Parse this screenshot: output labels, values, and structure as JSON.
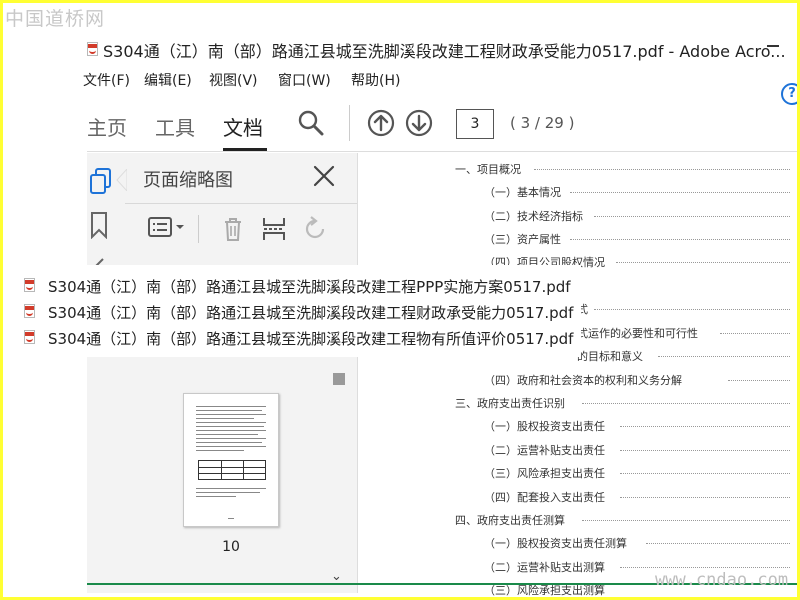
{
  "watermark_top": "中国道桥网",
  "watermark_bottom": "www.cndao.com",
  "window": {
    "title": "S304通（江）南（部）路通江县城至洗脚溪段改建工程财政承受能力0517.pdf - Adobe Acro..."
  },
  "menu": [
    {
      "label": "文件(F)"
    },
    {
      "label": "编辑(E)"
    },
    {
      "label": "视图(V)"
    },
    {
      "label": "窗口(W)"
    },
    {
      "label": "帮助(H)"
    }
  ],
  "toolbar": {
    "tabs": [
      {
        "label": "主页"
      },
      {
        "label": "工具"
      },
      {
        "label": "文档"
      }
    ],
    "page_current": "3",
    "page_count": "( 3 / 29 )"
  },
  "panel": {
    "title": "页面缩略图",
    "thumbnail_page_number": "10"
  },
  "toc": [
    {
      "text": "一、项目概况"
    },
    {
      "text": "（一）基本情况"
    },
    {
      "text": "（二）技术经济指标"
    },
    {
      "text": "（三）资产属性"
    },
    {
      "text": "（四）项目公司股权情况"
    },
    {
      "text": "式"
    },
    {
      "text": "式运作的必要性和可行性"
    },
    {
      "text": "的目标和意义"
    },
    {
      "text": "（四）政府和社会资本的权利和义务分解"
    },
    {
      "text": "三、政府支出责任识别"
    },
    {
      "text": "（一）股权投资支出责任"
    },
    {
      "text": "（二）运营补贴支出责任"
    },
    {
      "text": "（三）风险承担支出责任"
    },
    {
      "text": "（四）配套投入支出责任"
    },
    {
      "text": "四、政府支出责任测算"
    },
    {
      "text": "（一）股权投资支出责任测算"
    },
    {
      "text": "（二）运营补贴支出测算"
    },
    {
      "text": "（三）风险承担支出测算"
    }
  ],
  "popup_files": [
    {
      "name": "S304通（江）南（部）路通江县城至洗脚溪段改建工程PPP实施方案0517.pdf"
    },
    {
      "name": "S304通（江）南（部）路通江县城至洗脚溪段改建工程财政承受能力0517.pdf"
    },
    {
      "name": "S304通（江）南（部）路通江县城至洗脚溪段改建工程物有所值评价0517.pdf"
    }
  ],
  "colors": {
    "border": "#ffff33",
    "accent": "#1e73d8",
    "pdf_red": "#d23b2a",
    "status_line": "#1a8a4a"
  }
}
